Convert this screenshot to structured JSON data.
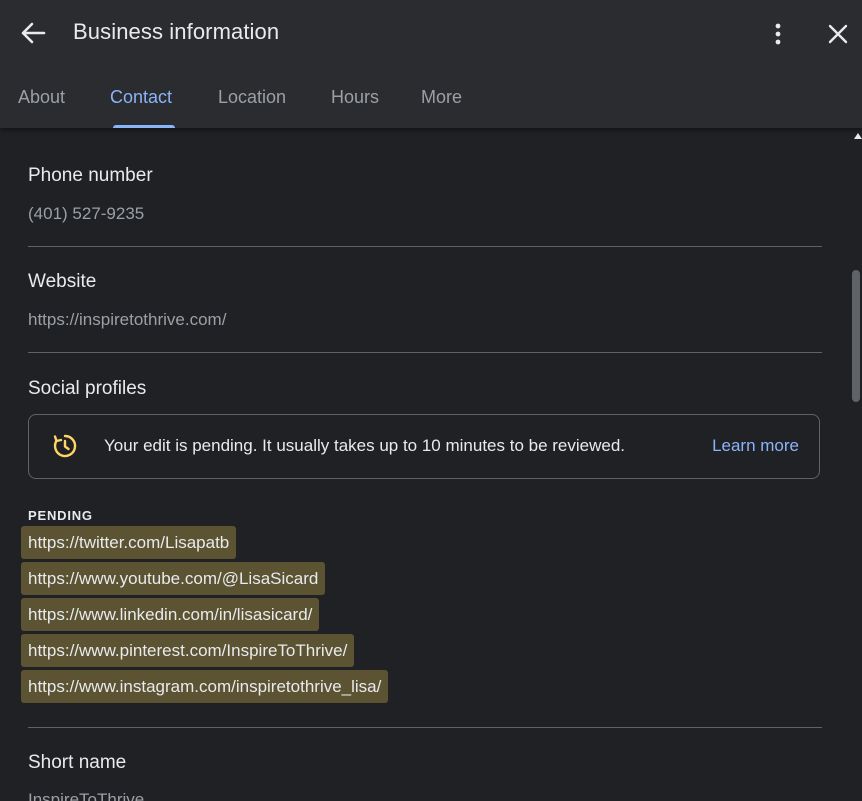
{
  "header": {
    "title": "Business information",
    "back_icon": "arrow-back-icon",
    "more_icon": "more-vert-icon",
    "close_icon": "close-icon"
  },
  "tabs": [
    {
      "label": "About",
      "active": false
    },
    {
      "label": "Contact",
      "active": true
    },
    {
      "label": "Location",
      "active": false
    },
    {
      "label": "Hours",
      "active": false
    },
    {
      "label": "More",
      "active": false
    }
  ],
  "contact": {
    "phone": {
      "title": "Phone number",
      "value": "(401) 527-9235"
    },
    "website": {
      "title": "Website",
      "value": "https://inspiretothrive.com/"
    },
    "social": {
      "title": "Social profiles",
      "notice": {
        "icon": "pending-clock-icon",
        "text": "Your edit is pending. It usually takes up to 10 minutes to be reviewed.",
        "link": "Learn more"
      },
      "pending_label": "PENDING",
      "links": [
        "https://twitter.com/Lisapatb",
        "https://www.youtube.com/@LisaSicard",
        "https://www.linkedin.com/in/lisasicard/",
        "https://www.pinterest.com/InspireToThrive/",
        "https://www.instagram.com/inspiretothrive_lisa/"
      ]
    },
    "short_name": {
      "title": "Short name",
      "value": "InspireToThrive"
    }
  },
  "colors": {
    "background": "#202124",
    "header": "#2b2c2f",
    "accent": "#8ab4f8",
    "pending_highlight": "#5b5332",
    "notice_icon": "#fdd663"
  }
}
